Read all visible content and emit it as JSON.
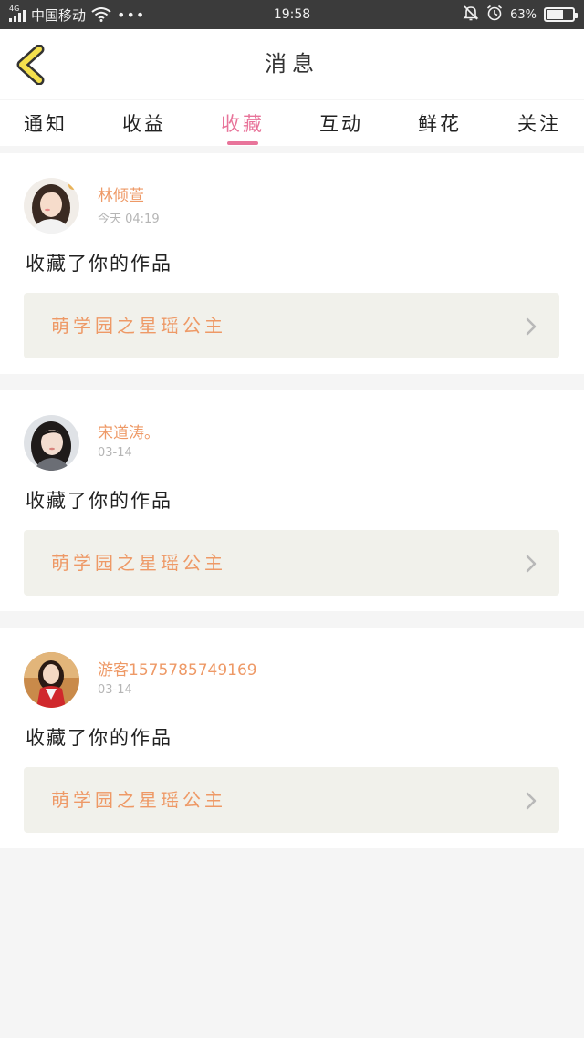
{
  "status_bar": {
    "network": "4G",
    "carrier": "中国移动",
    "more": "•••",
    "time": "19:58",
    "battery_percent": "63%",
    "battery_level": 0.63,
    "icons": [
      "signal-icon",
      "wifi-icon",
      "mute-bell-icon",
      "alarm-icon",
      "battery-icon"
    ]
  },
  "header": {
    "title": "消息",
    "back_icon": "back-chevron-icon"
  },
  "tabs": [
    {
      "label": "通知",
      "active": false
    },
    {
      "label": "收益",
      "active": false
    },
    {
      "label": "收藏",
      "active": true
    },
    {
      "label": "互动",
      "active": false
    },
    {
      "label": "鲜花",
      "active": false
    },
    {
      "label": "关注",
      "active": false
    }
  ],
  "messages": [
    {
      "username": "林倾萱",
      "time": "今天 04:19",
      "action": "收藏了你的作品",
      "work_title": "萌学园之星瑶公主"
    },
    {
      "username": "宋道涛。",
      "time": "03-14",
      "action": "收藏了你的作品",
      "work_title": "萌学园之星瑶公主"
    },
    {
      "username": "游客1575785749169",
      "time": "03-14",
      "action": "收藏了你的作品",
      "work_title": "萌学园之星瑶公主"
    }
  ],
  "colors": {
    "accent_pink": "#e8749a",
    "name_orange": "#ee9966",
    "back_yellow": "#f4e04d",
    "status_bar_bg": "#3b3b3b",
    "page_bg": "#f5f5f5",
    "work_box_bg": "#f1f1eb"
  }
}
